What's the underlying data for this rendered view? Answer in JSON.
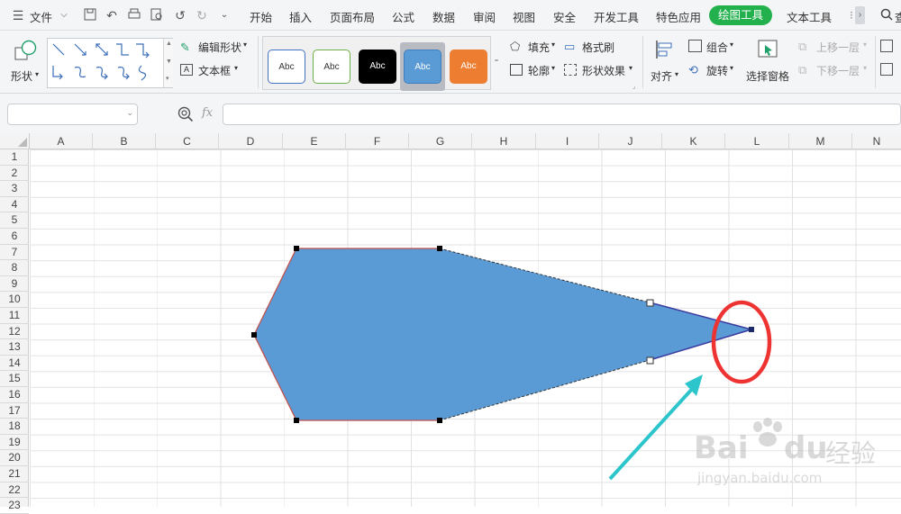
{
  "menubar": {
    "file_label": "文件",
    "tabs": [
      "开始",
      "插入",
      "页面布局",
      "公式",
      "数据",
      "审阅",
      "视图",
      "安全",
      "开发工具",
      "特色应用"
    ],
    "active_tab": "绘图工具",
    "after_tabs": [
      "文本工具"
    ],
    "search_glyph": "查",
    "active_color": "#22b14c"
  },
  "ribbon": {
    "shape_label": "形状",
    "edit_shape_label": "编辑形状",
    "textbox_label": "文本框",
    "style_samples": [
      {
        "text": "Abc",
        "variant": "outline-blue"
      },
      {
        "text": "Abc",
        "variant": "outline-green"
      },
      {
        "text": "Abc",
        "variant": "fill-black"
      },
      {
        "text": "Abc",
        "variant": "fill-blue"
      },
      {
        "text": "Abc",
        "variant": "fill-orange"
      }
    ],
    "fill_label": "填充",
    "format_painter_label": "格式刷",
    "outline_label": "轮廓",
    "shape_effect_label": "形状效果",
    "align_label": "对齐",
    "group_label": "组合",
    "rotate_label": "旋转",
    "selection_pane_label": "选择窗格",
    "bring_forward_label": "上移一层",
    "send_backward_label": "下移一层"
  },
  "formula": {
    "fx_label": "fx",
    "name_box_value": "",
    "formula_value": ""
  },
  "sheet": {
    "columns": [
      "A",
      "B",
      "C",
      "D",
      "E",
      "F",
      "G",
      "H",
      "I",
      "J",
      "K",
      "L",
      "M",
      "N"
    ],
    "rows": [
      "1",
      "2",
      "3",
      "4",
      "5",
      "6",
      "7",
      "8",
      "9",
      "10",
      "11",
      "12",
      "13",
      "14",
      "15",
      "16",
      "17",
      "18",
      "19",
      "20",
      "21",
      "22",
      "23"
    ]
  },
  "shape": {
    "fill_color": "#5b9bd5",
    "outline_color": "#c0504d",
    "edited_edge_color": "#3a3aa0",
    "highlight_color": "#ee3333",
    "arrow_color": "#2dc5cc"
  },
  "watermark": {
    "brand": "Bai",
    "brand2": "du",
    "cn": "经验",
    "url": "jingyan.baidu.com"
  }
}
